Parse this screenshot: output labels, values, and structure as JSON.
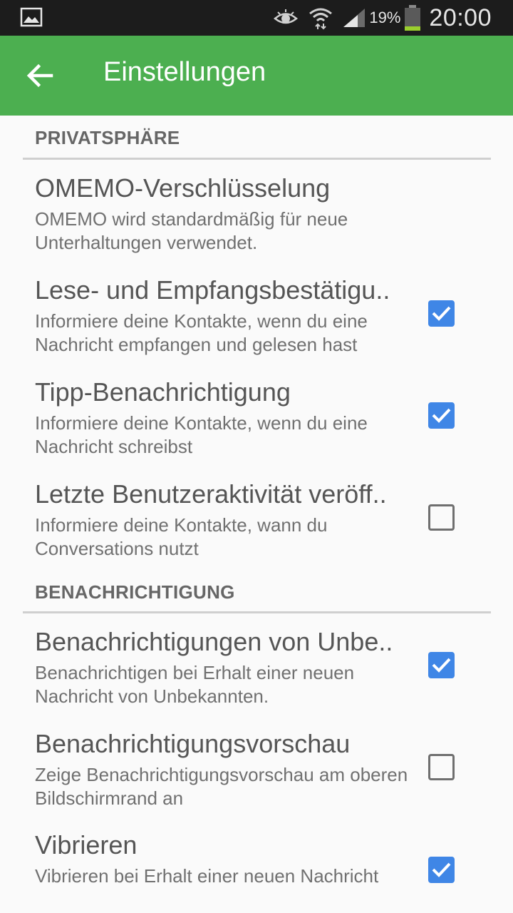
{
  "status_bar": {
    "battery_percent": "19%",
    "time": "20:00"
  },
  "toolbar": {
    "title": "Einstellungen"
  },
  "sections": [
    {
      "header": "PRIVATSPHÄRE"
    },
    {
      "header": "BENACHRICHTIGUNG"
    }
  ],
  "prefs": [
    {
      "title": "OMEMO-Verschlüsselung",
      "summary": "OMEMO wird standardmäßig für neue Unterhaltungen verwendet.",
      "checked": null
    },
    {
      "title": "Lese- und Empfangsbestätigu..",
      "summary": "Informiere deine Kontakte, wenn du eine Nachricht empfangen und gelesen hast",
      "checked": true
    },
    {
      "title": "Tipp-Benachrichtigung",
      "summary": "Informiere deine Kontakte, wenn du eine Nachricht schreibst",
      "checked": true
    },
    {
      "title": "Letzte Benutzeraktivität veröff..",
      "summary": "Informiere deine Kontakte, wann du Conversations nutzt",
      "checked": false
    },
    {
      "title": "Benachrichtigungen von Unbe..",
      "summary": "Benachrichtigen bei Erhalt einer neuen Nachricht von Unbekannten.",
      "checked": true
    },
    {
      "title": "Benachrichtigungsvorschau",
      "summary": "Zeige Benachrichtigungsvorschau am oberen Bildschirmrand an",
      "checked": false
    },
    {
      "title": "Vibrieren",
      "summary": "Vibrieren bei Erhalt einer neuen Nachricht",
      "checked": true
    }
  ],
  "colors": {
    "toolbar": "#4caf50",
    "checkbox_on": "#3f86e6",
    "status_bar": "#1c1c1c"
  },
  "icons": {
    "status_left": "image-icon",
    "status_right": [
      "eye-icon",
      "wifi-icon",
      "signal-icon",
      "battery-icon"
    ],
    "toolbar": "arrow-back-icon",
    "checkbox": "check-icon"
  }
}
